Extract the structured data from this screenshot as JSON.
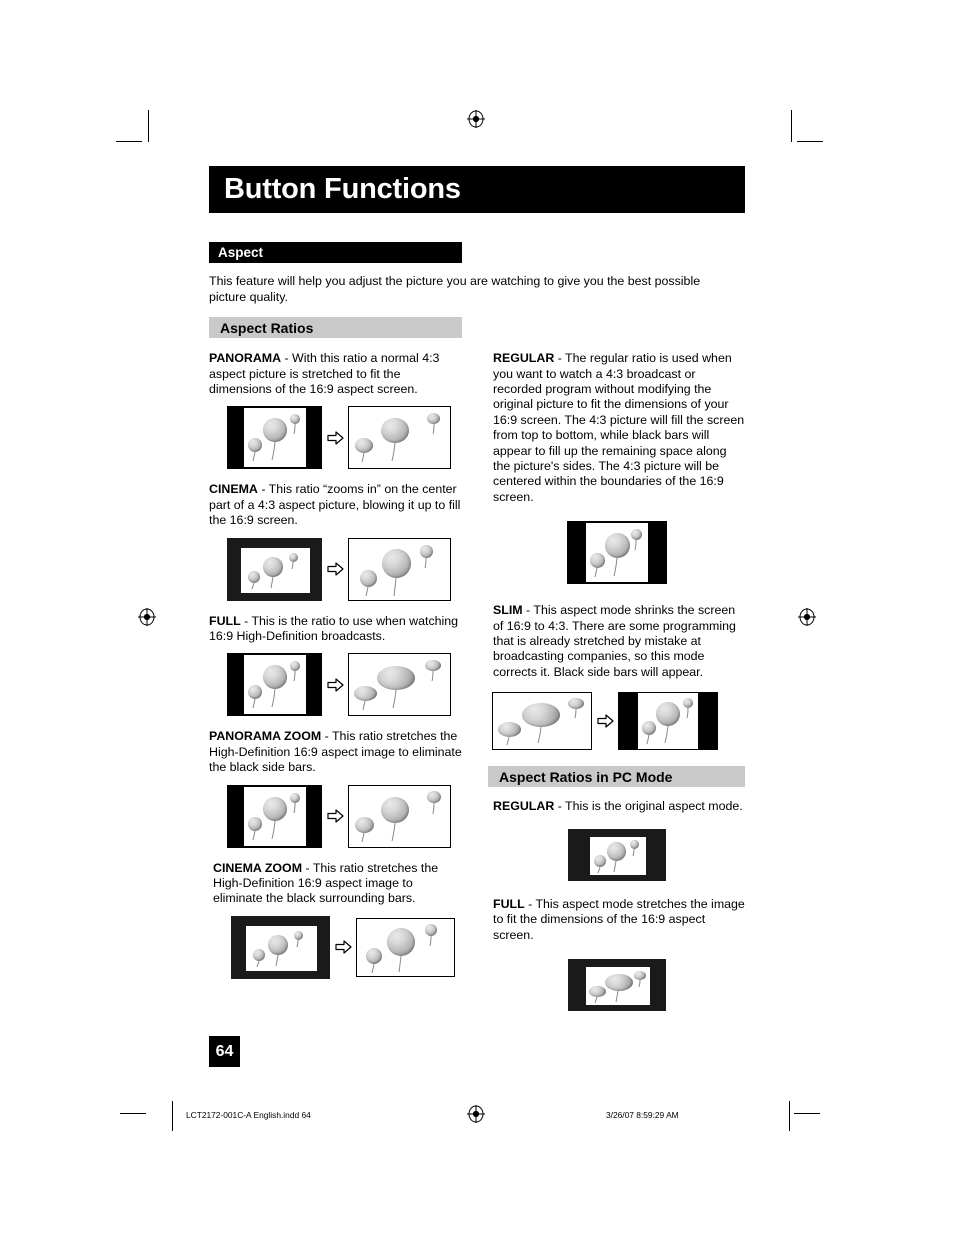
{
  "document": {
    "chapter_title": "Button Functions",
    "page_number": "64"
  },
  "sections": {
    "aspect_head": "Aspect",
    "aspect_intro": "This feature will help you adjust the picture you are watching to give you the best possible picture quality.",
    "aspect_ratios_head": "Aspect Ratios",
    "pc_mode_head": "Aspect Ratios in PC Mode"
  },
  "left_column": [
    {
      "term": "PANORAMA",
      "body": " - With this ratio a normal 4:3 aspect picture is stretched to fit the dimensions of the 16:9 aspect screen."
    },
    {
      "term": "CINEMA",
      "body": " - This ratio “zooms in” on the center part of a 4:3 aspect picture, blowing it up to fill the 16:9 screen."
    },
    {
      "term": "FULL",
      "body": " - This is the ratio to use when watching 16:9 High-Definition broadcasts."
    },
    {
      "term": "PANORAMA ZOOM",
      "body": " - This ratio stretches the High-Definition 16:9 aspect image to eliminate the black side bars."
    },
    {
      "term": "CINEMA ZOOM",
      "body": " - This ratio stretches the High-Definition 16:9 aspect image to eliminate the black surrounding bars."
    }
  ],
  "right_column": [
    {
      "term": "REGULAR",
      "body": " - The regular ratio is used when you want to watch a 4:3 broadcast or recorded program without modifying the original picture to fit the dimensions of your 16:9 screen. The 4:3 picture will fill the screen from top to bottom, while black bars will appear to fill up the remaining space along the picture's sides. The 4:3 picture will be centered within the boundaries of the 16:9 screen."
    },
    {
      "term": "SLIM",
      "body": " - This aspect mode shrinks the screen of 16:9 to 4:3.  There are some programming that is already stretched by mistake at broadcasting companies, so this mode corrects it.  Black side bars will appear."
    }
  ],
  "pc_mode_column": [
    {
      "term": "REGULAR",
      "body": " - This is the original aspect mode."
    },
    {
      "term": "FULL",
      "body": " - This aspect mode stretches the image to fit the dimensions of the 16:9 aspect screen."
    }
  ],
  "icons": {
    "transform_arrow": "right-arrow-outline",
    "registration": "registration-target"
  },
  "footer": {
    "file_label": "LCT2172-001C-A English.indd   64",
    "timestamp": "3/26/07   8:59:29 AM"
  },
  "colors": {
    "bar_black": "#000000",
    "head_gray": "#c9c9c9",
    "page_white": "#ffffff"
  }
}
